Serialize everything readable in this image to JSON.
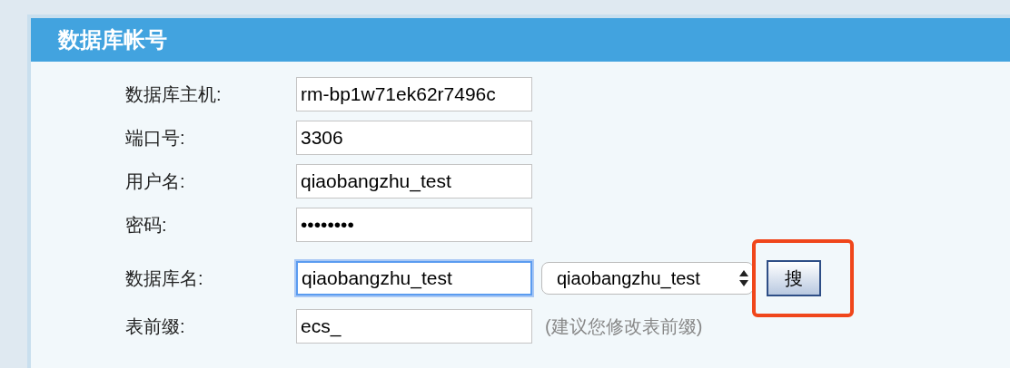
{
  "panel": {
    "title": "数据库帐号"
  },
  "fields": [
    {
      "kind": "text",
      "label": "数据库主机:",
      "value": "rm-bp1w71ek62r7496c",
      "focused": false
    },
    {
      "kind": "text",
      "label": "端口号:",
      "value": "3306",
      "focused": false
    },
    {
      "kind": "text",
      "label": "用户名:",
      "value": "qiaobangzhu_test",
      "focused": false
    },
    {
      "kind": "password",
      "label": "密码:",
      "value": "••••••••",
      "focused": false
    },
    {
      "kind": "dbname",
      "label": "数据库名:",
      "value": "qiaobangzhu_test",
      "focused": true,
      "select": "qiaobangzhu_test",
      "button": {
        "label": "搜",
        "highlighted": true
      }
    },
    {
      "kind": "prefix",
      "label": "表前缀:",
      "value": "ecs_",
      "focused": false,
      "hint": "(建议您修改表前缀)"
    }
  ]
}
